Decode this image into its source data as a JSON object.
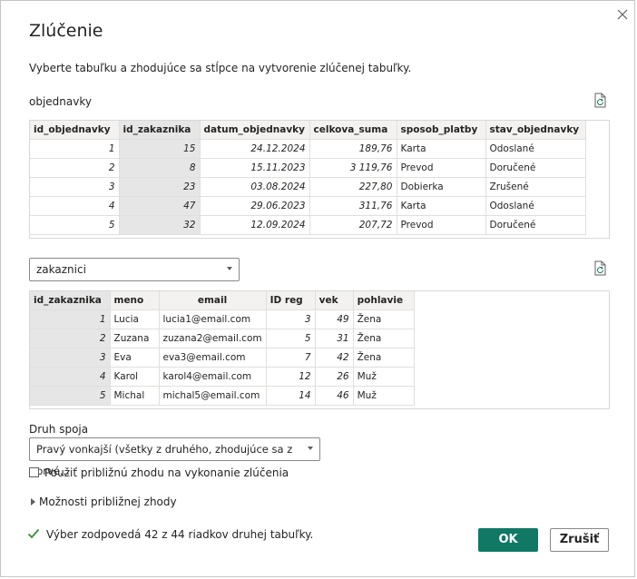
{
  "dialog": {
    "title": "Zlúčenie",
    "subtitle": "Vyberte tabuľku a zhodujúce sa stĺpce na vytvorenie zlúčenej tabuľky."
  },
  "table1": {
    "name": "objednavky",
    "columns": [
      "id_objednavky",
      "id_zakaznika",
      "datum_objednavky",
      "celkova_suma",
      "sposob_platby",
      "stav_objednavky"
    ],
    "rows": [
      [
        "1",
        "15",
        "24.12.2024",
        "189,76",
        "Karta",
        "Odoslané"
      ],
      [
        "2",
        "8",
        "15.11.2023",
        "3 119,76",
        "Prevod",
        "Doručené"
      ],
      [
        "3",
        "23",
        "03.08.2024",
        "227,80",
        "Dobierka",
        "Zrušené"
      ],
      [
        "4",
        "47",
        "29.06.2023",
        "311,76",
        "Karta",
        "Odoslané"
      ],
      [
        "5",
        "32",
        "12.09.2024",
        "207,72",
        "Prevod",
        "Doručené"
      ]
    ]
  },
  "table2": {
    "selected": "zakaznici",
    "columns": [
      "id_zakaznika",
      "meno",
      "email",
      "ID reg",
      "vek",
      "pohlavie"
    ],
    "rows": [
      [
        "1",
        "Lucia",
        "lucia1@email.com",
        "3",
        "49",
        "Žena"
      ],
      [
        "2",
        "Zuzana",
        "zuzana2@email.com",
        "5",
        "31",
        "Žena"
      ],
      [
        "3",
        "Eva",
        "eva3@email.com",
        "7",
        "42",
        "Žena"
      ],
      [
        "4",
        "Karol",
        "karol4@email.com",
        "12",
        "26",
        "Muž"
      ],
      [
        "5",
        "Michal",
        "michal5@email.com",
        "14",
        "46",
        "Muž"
      ]
    ]
  },
  "join": {
    "label": "Druh spoja",
    "selected": "Pravý vonkajší (všetky z druhého, zhodujúce sa z prvé...",
    "fuzzy_checkbox_label": "Použiť približnú zhodu na vykonanie zlúčenia",
    "fuzzy_options_label": "Možnosti približnej zhody"
  },
  "status": {
    "text": "Výber zodpovedá 42 z 44 riadkov druhej tabuľky."
  },
  "buttons": {
    "ok": "OK",
    "cancel": "Zrušiť"
  },
  "colors": {
    "accent": "#117865",
    "check": "#3a8f3a",
    "selected_column": "#e6e6e6"
  },
  "icons": [
    "close-icon",
    "refresh-icon",
    "chevron-down-icon",
    "expand-triangle-icon",
    "checkmark-icon"
  ]
}
